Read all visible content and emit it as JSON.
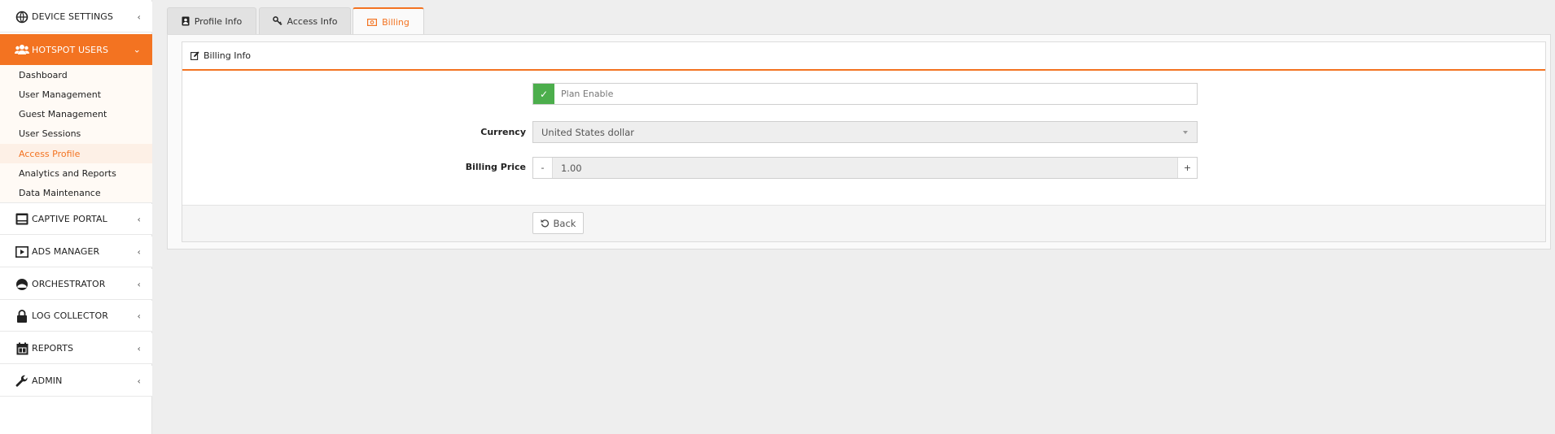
{
  "sidebar": {
    "device_settings": "DEVICE SETTINGS",
    "hotspot_users": "HOTSPOT USERS",
    "submenu": [
      "Dashboard",
      "User Management",
      "Guest Management",
      "User Sessions",
      "Access Profile",
      "Analytics and Reports",
      "Data Maintenance"
    ],
    "captive_portal": "CAPTIVE PORTAL",
    "ads_manager": "ADS MANAGER",
    "orchestrator": "ORCHESTRATOR",
    "log_collector": "LOG COLLECTOR",
    "reports": "REPORTS",
    "admin": "ADMIN",
    "chevron_collapsed": "‹",
    "chevron_expanded": "⌄"
  },
  "tabs": {
    "profile_info": "Profile Info",
    "access_info": "Access Info",
    "billing": "Billing"
  },
  "panel": {
    "title": "Billing Info",
    "plan_enable": {
      "label": "Plan Enable",
      "checked": true,
      "check_glyph": "✓"
    },
    "currency": {
      "label": "Currency",
      "value": "United States dollar"
    },
    "billing_price": {
      "label": "Billing Price",
      "value": "1.00",
      "minus": "-",
      "plus": "+"
    },
    "back_label": "Back"
  },
  "colors": {
    "accent": "#f37321",
    "check_green": "#4cae4c"
  }
}
